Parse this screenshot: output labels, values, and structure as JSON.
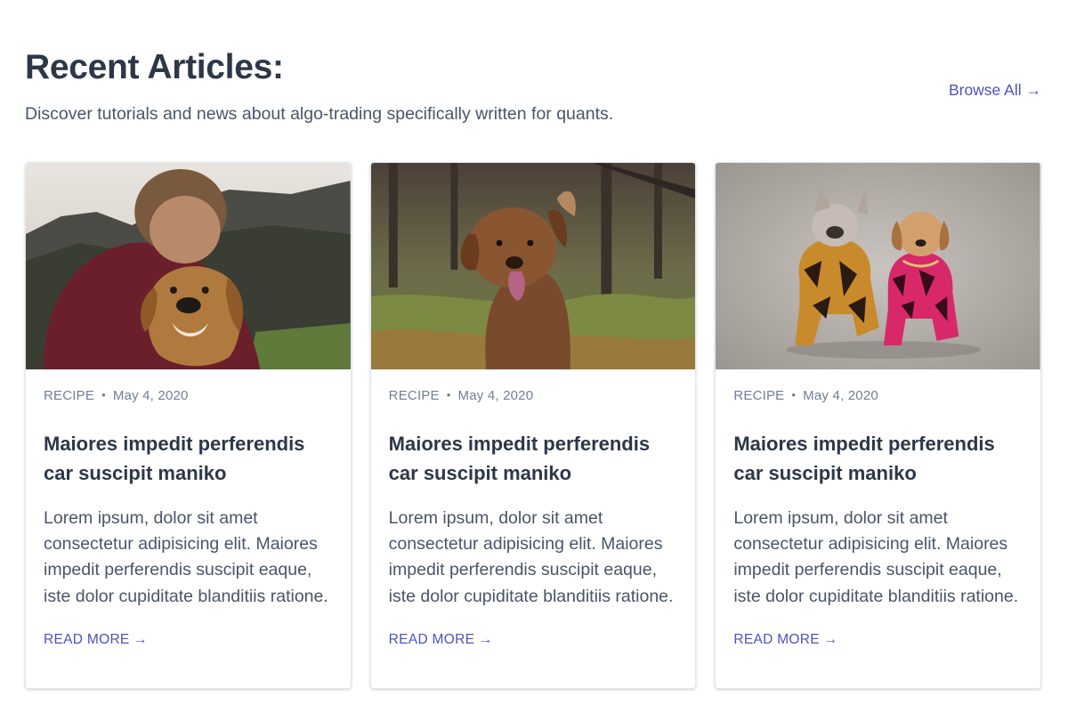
{
  "header": {
    "title": "Recent Articles:",
    "subtitle": "Discover tutorials and news about algo-trading specifically written for quants.",
    "browse_all": "Browse All →"
  },
  "colors": {
    "accent": "#4c51bf",
    "heading": "#2d3748",
    "body_text": "#4a5568",
    "meta_text": "#718096"
  },
  "cards": [
    {
      "image": "man-hugging-golden-retriever-photo",
      "category": "RECIPE",
      "separator": "•",
      "date": "May 4, 2020",
      "title": "Maiores impedit perferendis car suscipit maniko",
      "excerpt": "Lorem ipsum, dolor sit amet consectetur adipisicing elit. Maiores impedit perferendis suscipit eaque, iste dolor cupiditate blanditiis ratione.",
      "link": "READ MORE →"
    },
    {
      "image": "brown-dog-in-meadow-photo",
      "category": "RECIPE",
      "separator": "•",
      "date": "May 4, 2020",
      "title": "Maiores impedit perferendis car suscipit maniko",
      "excerpt": "Lorem ipsum, dolor sit amet consectetur adipisicing elit. Maiores impedit perferendis suscipit eaque, iste dolor cupiditate blanditiis ratione.",
      "link": "READ MORE →"
    },
    {
      "image": "two-dogs-in-jackets-photo",
      "category": "RECIPE",
      "separator": "•",
      "date": "May 4, 2020",
      "title": "Maiores impedit perferendis car suscipit maniko",
      "excerpt": "Lorem ipsum, dolor sit amet consectetur adipisicing elit. Maiores impedit perferendis suscipit eaque, iste dolor cupiditate blanditiis ratione.",
      "link": "READ MORE →"
    }
  ]
}
